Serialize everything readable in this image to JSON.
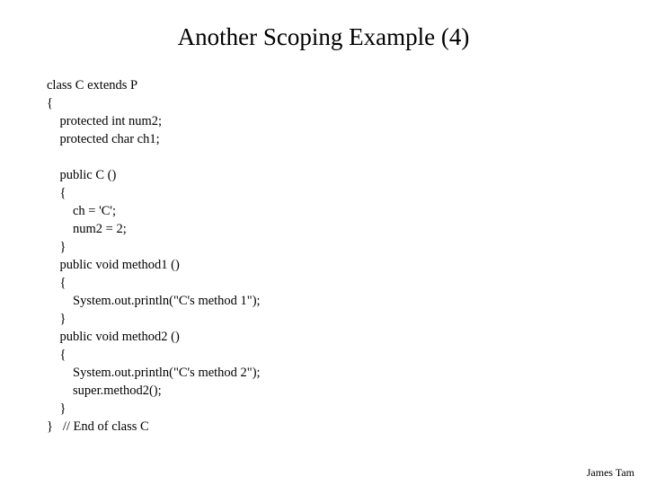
{
  "title": "Another Scoping Example (4)",
  "code": "class C extends P\n{\n    protected int num2;\n    protected char ch1;\n\n    public C ()\n    {\n        ch = 'C';\n        num2 = 2;\n    }\n    public void method1 ()\n    {\n        System.out.println(\"C's method 1\");\n    }\n    public void method2 ()\n    {\n        System.out.println(\"C's method 2\");\n        super.method2();\n    }\n}   // End of class C",
  "footer": "James Tam"
}
